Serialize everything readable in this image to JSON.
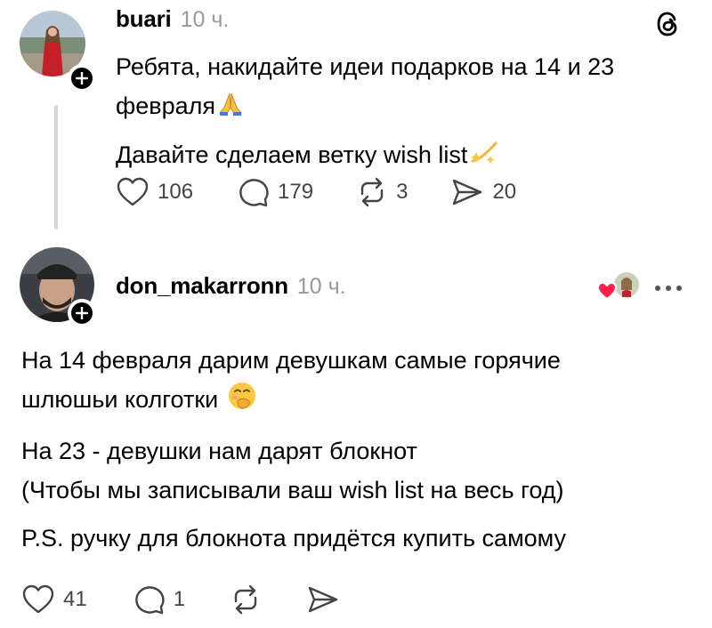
{
  "post1": {
    "username": "buari",
    "time": "10 ч.",
    "lines": [
      "Ребята, накидайте идеи подарков на 14 и 23",
      "февраля",
      "Давайте сделаем ветку wish list"
    ],
    "likes": "106",
    "replies": "179",
    "reposts": "3",
    "shares": "20"
  },
  "post2": {
    "username": "don_makarronn",
    "time": "10 ч.",
    "paragraphs": [
      [
        "На 14 февраля дарим девушкам самые горячие",
        "шлюшьи колготки"
      ],
      [
        "На 23 - девушки нам дарят блокнот",
        "(Чтобы мы записывали ваш wish list на весь год)"
      ],
      [
        "P.S. ручку для блокнота придётся купить самому"
      ]
    ],
    "likes": "41",
    "replies": "1"
  },
  "icons": [
    "threads-logo-icon",
    "plus-icon",
    "heart-icon",
    "comment-icon",
    "repost-icon",
    "share-icon",
    "more-icon",
    "praying-hands-emoji",
    "sparkles-emoji",
    "hand-over-mouth-emoji",
    "liked-by-badge-icon"
  ]
}
